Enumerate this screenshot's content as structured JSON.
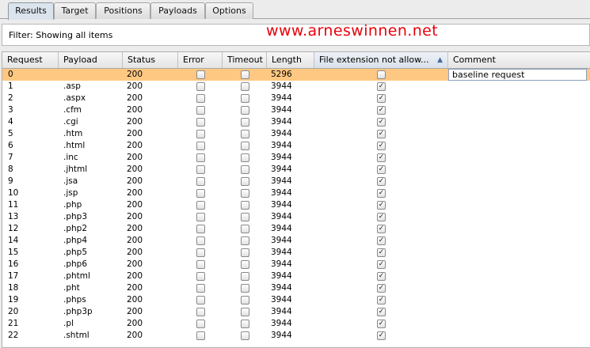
{
  "tabs": [
    {
      "label": "Results",
      "active": true
    },
    {
      "label": "Target",
      "active": false
    },
    {
      "label": "Positions",
      "active": false
    },
    {
      "label": "Payloads",
      "active": false
    },
    {
      "label": "Options",
      "active": false
    }
  ],
  "filter": {
    "text": "Filter:  Showing all items"
  },
  "watermark": "www.arneswinnen.net",
  "table": {
    "columns": [
      "Request",
      "Payload",
      "Status",
      "Error",
      "Timeout",
      "Length",
      "File extension not allow...",
      "Comment"
    ],
    "sorted_column": "File extension not allow...",
    "sort_direction": "ascending",
    "rows": [
      {
        "request": "0",
        "payload": "",
        "status": "200",
        "error": false,
        "timeout": false,
        "length": "5296",
        "file_ext": false,
        "comment": "baseline request",
        "selected": true
      },
      {
        "request": "1",
        "payload": ".asp",
        "status": "200",
        "error": false,
        "timeout": false,
        "length": "3944",
        "file_ext": true,
        "comment": ""
      },
      {
        "request": "2",
        "payload": ".aspx",
        "status": "200",
        "error": false,
        "timeout": false,
        "length": "3944",
        "file_ext": true,
        "comment": ""
      },
      {
        "request": "3",
        "payload": ".cfm",
        "status": "200",
        "error": false,
        "timeout": false,
        "length": "3944",
        "file_ext": true,
        "comment": ""
      },
      {
        "request": "4",
        "payload": ".cgi",
        "status": "200",
        "error": false,
        "timeout": false,
        "length": "3944",
        "file_ext": true,
        "comment": ""
      },
      {
        "request": "5",
        "payload": ".htm",
        "status": "200",
        "error": false,
        "timeout": false,
        "length": "3944",
        "file_ext": true,
        "comment": ""
      },
      {
        "request": "6",
        "payload": ".html",
        "status": "200",
        "error": false,
        "timeout": false,
        "length": "3944",
        "file_ext": true,
        "comment": ""
      },
      {
        "request": "7",
        "payload": ".inc",
        "status": "200",
        "error": false,
        "timeout": false,
        "length": "3944",
        "file_ext": true,
        "comment": ""
      },
      {
        "request": "8",
        "payload": ".jhtml",
        "status": "200",
        "error": false,
        "timeout": false,
        "length": "3944",
        "file_ext": true,
        "comment": ""
      },
      {
        "request": "9",
        "payload": ".jsa",
        "status": "200",
        "error": false,
        "timeout": false,
        "length": "3944",
        "file_ext": true,
        "comment": ""
      },
      {
        "request": "10",
        "payload": ".jsp",
        "status": "200",
        "error": false,
        "timeout": false,
        "length": "3944",
        "file_ext": true,
        "comment": ""
      },
      {
        "request": "11",
        "payload": ".php",
        "status": "200",
        "error": false,
        "timeout": false,
        "length": "3944",
        "file_ext": true,
        "comment": ""
      },
      {
        "request": "13",
        "payload": ".php3",
        "status": "200",
        "error": false,
        "timeout": false,
        "length": "3944",
        "file_ext": true,
        "comment": ""
      },
      {
        "request": "12",
        "payload": ".php2",
        "status": "200",
        "error": false,
        "timeout": false,
        "length": "3944",
        "file_ext": true,
        "comment": ""
      },
      {
        "request": "14",
        "payload": ".php4",
        "status": "200",
        "error": false,
        "timeout": false,
        "length": "3944",
        "file_ext": true,
        "comment": ""
      },
      {
        "request": "15",
        "payload": ".php5",
        "status": "200",
        "error": false,
        "timeout": false,
        "length": "3944",
        "file_ext": true,
        "comment": ""
      },
      {
        "request": "16",
        "payload": ".php6",
        "status": "200",
        "error": false,
        "timeout": false,
        "length": "3944",
        "file_ext": true,
        "comment": ""
      },
      {
        "request": "17",
        "payload": ".phtml",
        "status": "200",
        "error": false,
        "timeout": false,
        "length": "3944",
        "file_ext": true,
        "comment": ""
      },
      {
        "request": "18",
        "payload": ".pht",
        "status": "200",
        "error": false,
        "timeout": false,
        "length": "3944",
        "file_ext": true,
        "comment": ""
      },
      {
        "request": "19",
        "payload": ".phps",
        "status": "200",
        "error": false,
        "timeout": false,
        "length": "3944",
        "file_ext": true,
        "comment": ""
      },
      {
        "request": "20",
        "payload": ".php3p",
        "status": "200",
        "error": false,
        "timeout": false,
        "length": "3944",
        "file_ext": true,
        "comment": ""
      },
      {
        "request": "21",
        "payload": ".pl",
        "status": "200",
        "error": false,
        "timeout": false,
        "length": "3944",
        "file_ext": true,
        "comment": ""
      },
      {
        "request": "22",
        "payload": ".shtml",
        "status": "200",
        "error": false,
        "timeout": false,
        "length": "3944",
        "file_ext": true,
        "comment": ""
      }
    ]
  },
  "colors": {
    "selected_row": "#ffc882",
    "watermark": "#e8000a",
    "active_tab": "#dbe3ec"
  }
}
